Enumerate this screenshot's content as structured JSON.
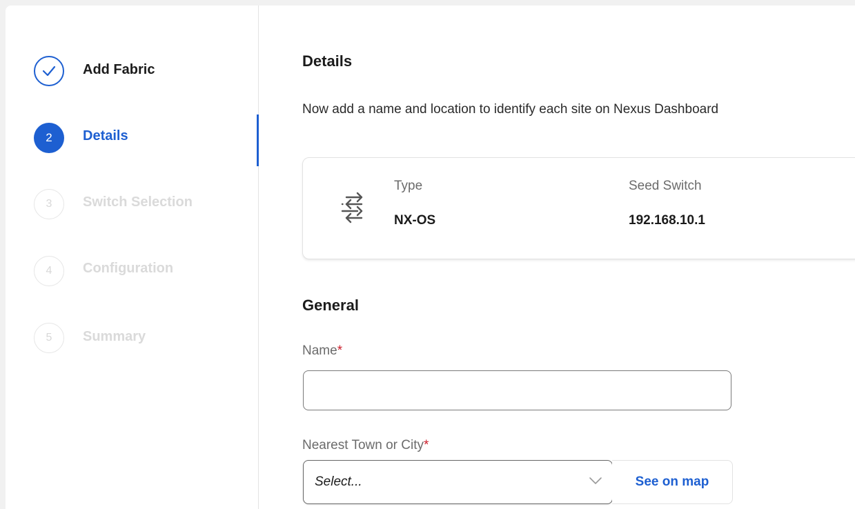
{
  "stepper": {
    "steps": [
      {
        "number": "1",
        "label": "Add Fabric",
        "state": "done"
      },
      {
        "number": "2",
        "label": "Details",
        "state": "current"
      },
      {
        "number": "3",
        "label": "Switch Selection",
        "state": "pending"
      },
      {
        "number": "4",
        "label": "Configuration",
        "state": "pending"
      },
      {
        "number": "5",
        "label": "Summary",
        "state": "pending"
      }
    ]
  },
  "details": {
    "title": "Details",
    "description": "Now add a name and location to identify each site on Nexus Dashboard",
    "card": {
      "icon": "switch-arrows-icon",
      "type_label": "Type",
      "type_value": "NX-OS",
      "seed_label": "Seed Switch",
      "seed_value": "192.168.10.1"
    }
  },
  "general": {
    "title": "General",
    "name_label": "Name",
    "name_value": "",
    "required_mark": "*",
    "city_label": "Nearest Town or City",
    "city_select_value": "Select...",
    "see_on_map_label": "See on map"
  },
  "colors": {
    "accent": "#1d5fd1",
    "required": "#cc1e2b",
    "muted_text": "#6b6b6b",
    "pending_step": "#dadada"
  }
}
